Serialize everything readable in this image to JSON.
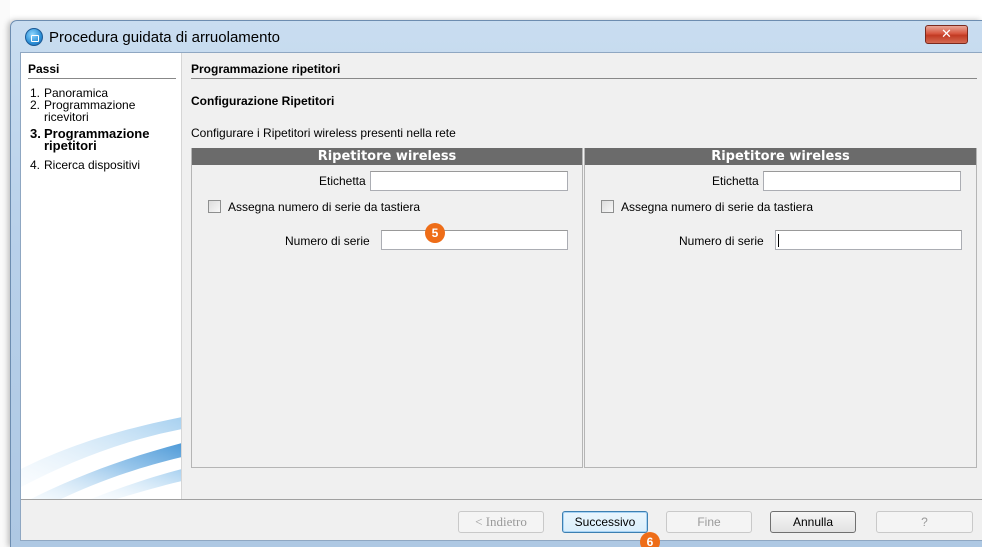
{
  "window": {
    "title": "Procedura guidata di arruolamento",
    "close_label": "✕"
  },
  "steps": {
    "title": "Passi",
    "items": [
      {
        "num": "1.",
        "label": "Panoramica",
        "active": false
      },
      {
        "num": "2.",
        "label": "Programmazione ricevitori",
        "active": false
      },
      {
        "num": "3.",
        "label": "Programmazione ripetitori",
        "active": true
      },
      {
        "num": "4.",
        "label": "Ricerca dispositivi",
        "active": false
      }
    ]
  },
  "main": {
    "page_title": "Programmazione ripetitori",
    "section_title": "Configurazione Ripetitori",
    "description": "Configurare i Ripetitori wireless presenti nella rete",
    "panels": [
      {
        "header": "Ripetitore wireless",
        "label_field": "Etichetta",
        "label_value": "",
        "checkbox_label": "Assegna numero di serie da tastiera",
        "checkbox_checked": false,
        "serial_field": "Numero di serie",
        "serial_value": ""
      },
      {
        "header": "Ripetitore wireless",
        "label_field": "Etichetta",
        "label_value": "",
        "checkbox_label": "Assegna numero di serie da tastiera",
        "checkbox_checked": false,
        "serial_field": "Numero di serie",
        "serial_value": ""
      }
    ]
  },
  "markers": {
    "serial_marker": "5",
    "next_marker": "6"
  },
  "footer": {
    "back_label": "< Indietro",
    "next_label": "Successivo",
    "finish_label": "Fine",
    "cancel_label": "Annulla",
    "help_label": "?"
  },
  "colors": {
    "panel_header": "#6b6b6b",
    "marker": "#ee6d18",
    "close_button": "#c9462f"
  }
}
